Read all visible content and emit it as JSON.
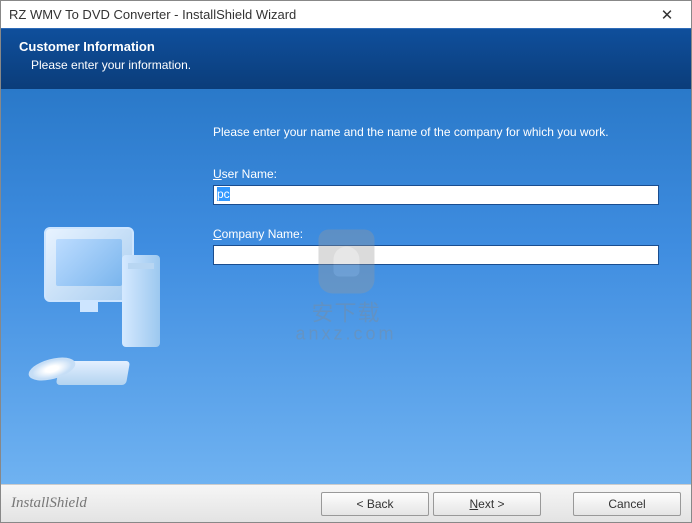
{
  "window": {
    "title": "RZ WMV To DVD Converter - InstallShield Wizard",
    "close_glyph": "✕"
  },
  "header": {
    "title": "Customer Information",
    "subtitle": "Please enter your information."
  },
  "main": {
    "instruction": "Please enter your name and the name of the company for which you work.",
    "user_label": "User Name:",
    "user_value": "pc",
    "company_label": "Company Name:",
    "company_value": ""
  },
  "footer": {
    "brand": "InstallShield",
    "back": "< Back",
    "next": "Next >",
    "cancel": "Cancel"
  },
  "watermark": {
    "line1": "安下载",
    "line2": "anxz.com"
  }
}
